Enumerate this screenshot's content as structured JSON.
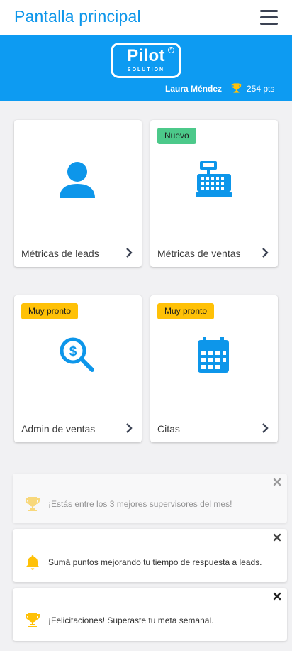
{
  "header": {
    "title": "Pantalla principal",
    "menu_icon": "hamburger-menu-icon"
  },
  "hero": {
    "logo_text": "Pilot",
    "logo_subtext": "SOLUTION",
    "logo_registered": "R",
    "user_name": "Laura Méndez",
    "points": "254 pts",
    "background_color": "#0d9bf2"
  },
  "cards": [
    {
      "label": "Métricas de leads",
      "badge": "",
      "icon": "user-icon"
    },
    {
      "label": "Métricas de ventas",
      "badge": "Nuevo",
      "icon": "cash-register-icon"
    },
    {
      "label": "Admin de ventas",
      "badge": "Muy pronto",
      "icon": "dollar-search-icon"
    },
    {
      "label": "Citas",
      "badge": "Muy pronto",
      "icon": "calendar-icon"
    }
  ],
  "notifications": [
    {
      "text": "¡Estás entre los 3 mejores supervisores del mes!",
      "icon": "trophy-icon",
      "state": "faded"
    },
    {
      "text": "Sumá puntos mejorando tu tiempo de respuesta a leads.",
      "icon": "bell-icon",
      "state": "normal"
    },
    {
      "text": "¡Felicitaciones! Superaste tu meta semanal.",
      "icon": "trophy-icon",
      "state": "normal"
    }
  ],
  "colors": {
    "accent": "#0d96ea",
    "badge_new": "#4cc98a",
    "badge_soon": "#ffc107",
    "icon_yellow": "#ffc107"
  }
}
